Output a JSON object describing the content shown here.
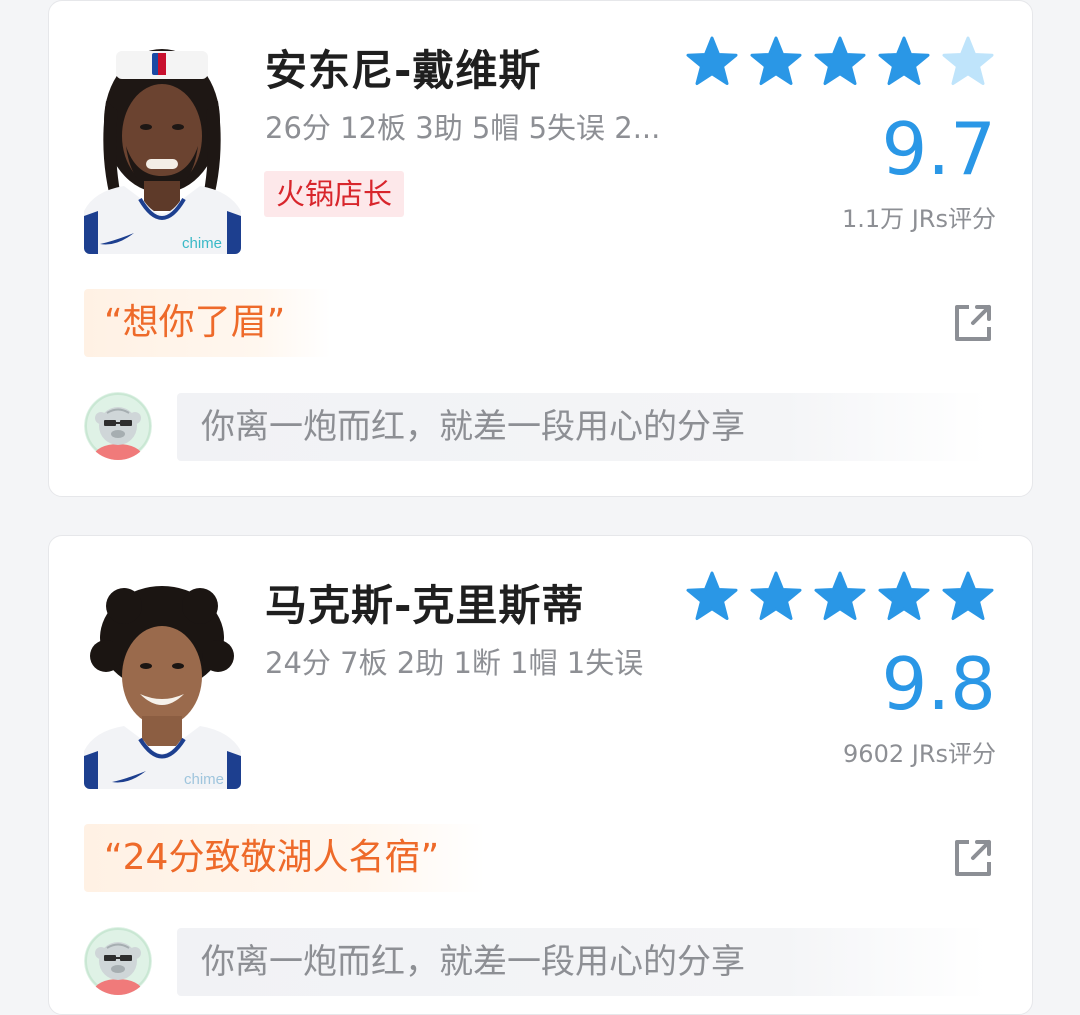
{
  "colors": {
    "star_full": "#2a97e6",
    "star_empty": "#bfe4fb",
    "score": "#2a97e6",
    "tag_text": "#d8262c",
    "tag_bg": "#fde8ea",
    "quote_text": "#ee6a2a"
  },
  "players": [
    {
      "name": "安东尼-戴维斯",
      "stats": "26分 12板 3助 5帽 5失误 2...",
      "tag": "火锅店长",
      "rating_stars": 4,
      "max_stars": 5,
      "score": "9.7",
      "ratings_count": "1.1万 JRs评分",
      "quote": "“想你了眉”",
      "comment_placeholder": "你离一炮而红，就差一段用心的分享",
      "jersey_logo": "chime"
    },
    {
      "name": "马克斯-克里斯蒂",
      "stats": "24分 7板 2助 1断 1帽 1失误",
      "rating_stars": 5,
      "max_stars": 5,
      "score": "9.8",
      "ratings_count": "9602 JRs评分",
      "quote": "“24分致敬湖人名宿”",
      "comment_placeholder": "你离一炮而红，就差一段用心的分享",
      "jersey_logo": "chime"
    }
  ],
  "icons": {
    "star": "star-icon",
    "share": "share-icon",
    "user_avatar": "user-avatar-icon"
  }
}
